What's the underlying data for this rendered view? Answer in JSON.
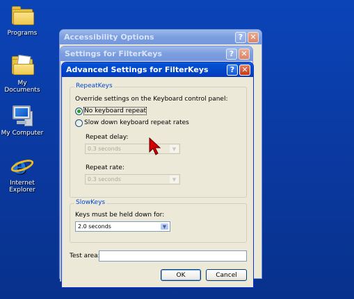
{
  "desktop": {
    "icons": [
      {
        "label": "Programs",
        "icon": "folder-icon"
      },
      {
        "label": "My Documents",
        "icon": "my-documents-icon"
      },
      {
        "label": "My Computer",
        "icon": "my-computer-icon"
      },
      {
        "label": "Internet Explorer",
        "icon": "internet-explorer-icon"
      }
    ]
  },
  "windows": {
    "accessibility": {
      "title": "Accessibility Options"
    },
    "settings": {
      "title": "Settings for FilterKeys"
    },
    "advanced": {
      "title": "Advanced Settings for FilterKeys"
    }
  },
  "title_buttons": {
    "help": "?",
    "close": "✕"
  },
  "repeat_keys": {
    "group_title": "RepeatKeys",
    "instruction": "Override settings on the Keyboard control panel:",
    "option_no_repeat": "No keyboard repeat",
    "option_slow": "Slow down keyboard repeat rates",
    "selected": "No keyboard repeat",
    "repeat_delay_label": "Repeat delay:",
    "repeat_delay_value": "0.3 seconds",
    "repeat_rate_label": "Repeat rate:",
    "repeat_rate_value": "0.3 seconds"
  },
  "slow_keys": {
    "group_title": "SlowKeys",
    "hold_label": "Keys must be held down for:",
    "hold_value": "2.0 seconds"
  },
  "test_area": {
    "label": "Test area:",
    "value": ""
  },
  "buttons": {
    "ok": "OK",
    "cancel": "Cancel"
  },
  "colors": {
    "desktop_blue": "#0a3aa3",
    "active_title": "#0348c8",
    "dialog_face": "#ece9d8",
    "group_title_text": "#0046d5",
    "cursor": "#d40000"
  }
}
